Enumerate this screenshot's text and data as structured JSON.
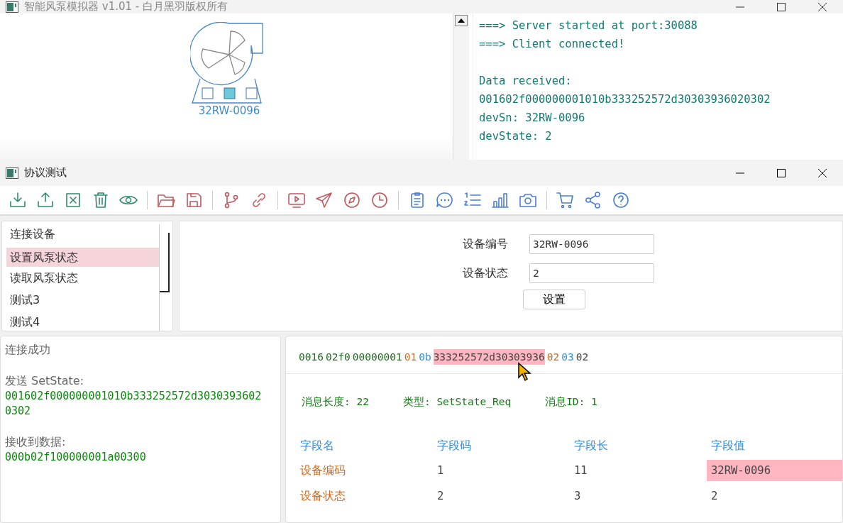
{
  "main_window": {
    "title": "智能风泵模拟器 v1.01 - 白月黑羽版权所有",
    "device": {
      "label": "32RW-0096",
      "lights": [
        {
          "on": false
        },
        {
          "on": true
        },
        {
          "on": false
        }
      ]
    },
    "log": [
      [
        "===> Server started at port:30088",
        "===> Client connected!"
      ],
      [
        "Data received:",
        "001602f000000001010b333252572d30303936020302",
        "devSn: 32RW-0096",
        "devState: 2"
      ]
    ]
  },
  "dialog": {
    "title": "协议测试",
    "list": [
      {
        "label": "连接设备",
        "selected": false
      },
      {
        "label": "设置风泵状态",
        "selected": true
      },
      {
        "label": "读取风泵状态",
        "selected": false
      },
      {
        "label": "测试3",
        "selected": false
      },
      {
        "label": "测试4",
        "selected": false
      }
    ],
    "form": {
      "fields": [
        {
          "label": "设备编号",
          "value": "32RW-0096"
        },
        {
          "label": "设备状态",
          "value": "2"
        }
      ],
      "button": "设置"
    },
    "messages": [
      {
        "label": "连接成功"
      },
      {
        "label": "发送 SetState:",
        "data": "001602f000000001010b333252572d30303936020302"
      },
      {
        "label": "接收到数据:",
        "data": "000b02f100000001a00300"
      }
    ],
    "hex": [
      {
        "text": "0016",
        "kind": "header",
        "selected": false
      },
      {
        "text": "02f0",
        "kind": "header",
        "selected": false
      },
      {
        "text": "00000001",
        "kind": "header",
        "selected": false
      },
      {
        "text": "01",
        "kind": "code",
        "selected": false
      },
      {
        "text": "0b",
        "kind": "length",
        "selected": false
      },
      {
        "text": "333252572d30303936",
        "kind": "value",
        "selected": true
      },
      {
        "text": "02",
        "kind": "code",
        "selected": false
      },
      {
        "text": "03",
        "kind": "length",
        "selected": false
      },
      {
        "text": "02",
        "kind": "value",
        "selected": false
      }
    ],
    "summary": [
      {
        "label": "消息长度:",
        "value": "22"
      },
      {
        "label": "类型:",
        "value": "SetState_Req"
      },
      {
        "label": "消息ID:",
        "value": "1"
      }
    ],
    "table": {
      "columns": [
        "字段名",
        "字段码",
        "字段长",
        "字段值"
      ],
      "rows": [
        {
          "name": "设备编码",
          "code": "1",
          "length": "11",
          "value": "32RW-0096",
          "selected": true
        },
        {
          "name": "设备状态",
          "code": "2",
          "length": "3",
          "value": "2",
          "selected": false
        }
      ]
    }
  }
}
